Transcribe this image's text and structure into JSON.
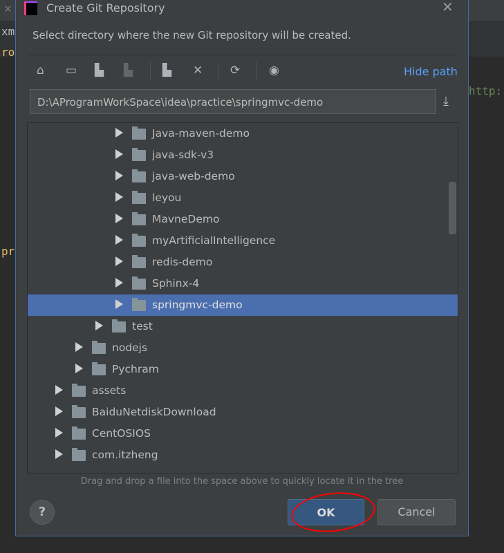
{
  "background": {
    "tab_fragment": "xm",
    "code_fragment_1": "ro",
    "code_fragment_2": "http:",
    "code_fragment_3": "pr"
  },
  "dialog": {
    "title": "Create Git Repository",
    "description": "Select directory where the new Git repository will be created.",
    "toolbar": {
      "icons": [
        "home-icon",
        "desktop-icon",
        "project-folder-icon",
        "module-folder-icon",
        "new-folder-icon",
        "delete-icon",
        "refresh-icon",
        "show-hidden-icon"
      ],
      "hide_path": "Hide path"
    },
    "path": "D:\\AProgramWorkSpace\\idea\\practice\\springmvc-demo",
    "tree": [
      {
        "label": "Java-maven-demo",
        "level": 3
      },
      {
        "label": "java-sdk-v3",
        "level": 3
      },
      {
        "label": "java-web-demo",
        "level": 3
      },
      {
        "label": "leyou",
        "level": 3
      },
      {
        "label": "MavneDemo",
        "level": 3
      },
      {
        "label": "myArtificialIntelligence",
        "level": 3
      },
      {
        "label": "redis-demo",
        "level": 3
      },
      {
        "label": "Sphinx-4",
        "level": 3
      },
      {
        "label": "springmvc-demo",
        "level": 3,
        "selected": true
      },
      {
        "label": "test",
        "level": 2
      },
      {
        "label": "nodejs",
        "level": 1
      },
      {
        "label": "Pychram",
        "level": 1
      },
      {
        "label": "assets",
        "level": 0
      },
      {
        "label": "BaiduNetdiskDownload",
        "level": 0
      },
      {
        "label": "CentOSIOS",
        "level": 0
      },
      {
        "label": "com.itzheng",
        "level": 0
      }
    ],
    "hint": "Drag and drop a file into the space above to quickly locate it in the tree",
    "help": "?",
    "ok": "OK",
    "cancel": "Cancel",
    "annotation_color": "#ff0000"
  }
}
